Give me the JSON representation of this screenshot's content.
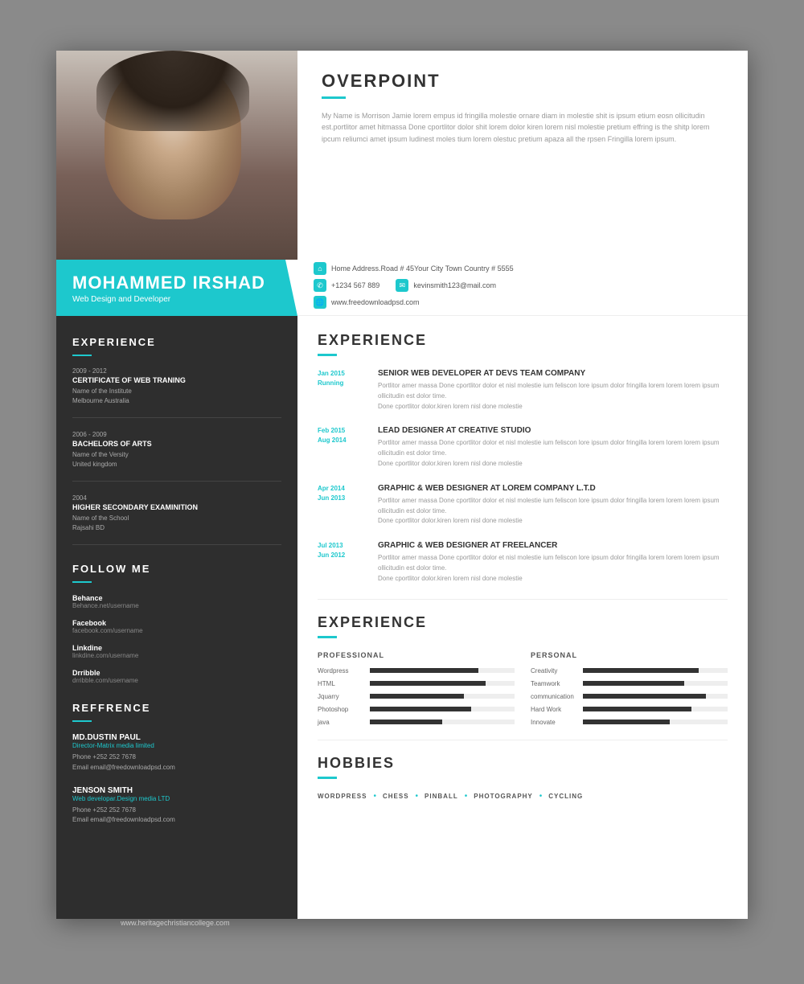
{
  "resume": {
    "overpoint": {
      "title": "OVERPOINT",
      "text": "My Name is Morrison Jamie lorem empus id fringilla molestie ornare diam in molestie shit is ipsum etium eosn ollicitudin est.portlitor amet hitmassa Done cportlitor dolor shit lorem dolor kiren lorem nisl molestie pretium effring is the shitp lorem ipcum reliumci amet ipsum ludinest moles tium lorem olestuc pretium apaza all the rpsen Fringilla lorem ipsum."
    },
    "name": "MOHAMMED IRSHAD",
    "title": "Web Design and Developer",
    "contact": {
      "address": "Home Address.Road # 45Your City Town Country # 5555",
      "phone": "+1234 567 889",
      "email": "kevinsmith123@mail.com",
      "website": "www.freedownloadpsd.com"
    },
    "sidebar": {
      "experience_title": "EXPERIENCE",
      "experience_items": [
        {
          "years": "2009 - 2012",
          "title": "CERTIFICATE OF WEB TRANING",
          "institute": "Name of the Institute",
          "location": "Melbourne Australia"
        },
        {
          "years": "2006 - 2009",
          "title": "BACHELORS OF ARTS",
          "institute": "Name of the Versity",
          "location": "United kingdom"
        },
        {
          "years": "2004",
          "title": "HIGHER SECONDARY EXAMINITION",
          "institute": "Name of the School",
          "location": "Rajsahi BD"
        }
      ],
      "follow_title": "FOLLOW ME",
      "follow_items": [
        {
          "name": "Behance",
          "url": "Behance.net/username"
        },
        {
          "name": "Facebook",
          "url": "facebook.com/username"
        },
        {
          "name": "Linkdine",
          "url": "linkdine.com/username"
        },
        {
          "name": "Drribble",
          "url": "drribble.com/username"
        }
      ],
      "reference_title": "REFFRENCE",
      "references": [
        {
          "name": "MD.DUSTIN PAUL",
          "role": "Director-Matrix media limited",
          "phone": "+252 252 7678",
          "email": "email@freedownloadpsd.com"
        },
        {
          "name": "JENSON SMITH",
          "role": "Web developar.Design media LTD",
          "phone": "+252 252 7678",
          "email": "email@freedownloadpsd.com"
        }
      ]
    },
    "main": {
      "experience_title": "EXPERIENCE",
      "experience_items": [
        {
          "date_start": "Jan 2015",
          "date_end": "Running",
          "title": "SENIOR WEB DEVELOPER AT DEVS TEAM COMPANY",
          "desc": "Portlitor amer massa Done cportlitor dolor et nisl molestie ium feliscon lore ipsum dolor fringilla lorem lorem lorem ipsum ollicitudin est dolor time.\nDone cportlitor dolor.kiren lorem nisl done molestie"
        },
        {
          "date_start": "Feb 2015",
          "date_end": "Aug 2014",
          "title": "LEAD DESIGNER AT CREATIVE STUDIO",
          "desc": "Portlitor amer massa Done cportlitor dolor et nisl molestie ium feliscon lore ipsum dolor fringilla lorem lorem lorem ipsum ollicitudin est dolor time.\nDone cportlitor dolor.kiren lorem nisl done molestie"
        },
        {
          "date_start": "Apr 2014",
          "date_end": "Jun 2013",
          "title": "GRAPHIC & WEB DESIGNER AT LOREM COMPANY L.T.D",
          "desc": "Portlitor amer massa Done cportlitor dolor et nisl molestie ium feliscon lore ipsum dolor fringilla lorem lorem lorem ipsum ollicitudin est dolor time.\nDone cportlitor dolor.kiren lorem nisl done molestie"
        },
        {
          "date_start": "Jul 2013",
          "date_end": "Jun 2012",
          "title": "GRAPHIC & WEB DESIGNER AT FREELANCER",
          "desc": "Portlitor amer massa Done cportlitor dolor et nisl molestie ium feliscon lore ipsum dolor fringilla lorem lorem lorem ipsum ollicitudin est dolor time.\nDone cportlitor dolor.kiren lorem nisl done molestie"
        }
      ],
      "skills_title": "EXPERIENCE",
      "professional_title": "PROFESSIONAL",
      "personal_title": "PERSONAL",
      "professional_skills": [
        {
          "label": "Wordpress",
          "pct": 75
        },
        {
          "label": "HTML",
          "pct": 80
        },
        {
          "label": "Jquarry",
          "pct": 65
        },
        {
          "label": "Photoshop",
          "pct": 70
        },
        {
          "label": "java",
          "pct": 50
        }
      ],
      "personal_skills": [
        {
          "label": "Creativity",
          "pct": 80
        },
        {
          "label": "Teamwork",
          "pct": 70
        },
        {
          "label": "communication",
          "pct": 85
        },
        {
          "label": "Hard Work",
          "pct": 75
        },
        {
          "label": "Innovate",
          "pct": 60
        }
      ],
      "hobbies_title": "HOBBIES",
      "hobbies": [
        "WORDPRESS",
        "CHESS",
        "PINBALL",
        "PHOTOGRAPHY",
        "CYCLING"
      ]
    }
  },
  "footer": {
    "url": "www.heritagechristiancollege.com"
  },
  "colors": {
    "teal": "#1dc8cd",
    "dark": "#2e2e2e",
    "text_dark": "#333333",
    "text_light": "#999999"
  }
}
